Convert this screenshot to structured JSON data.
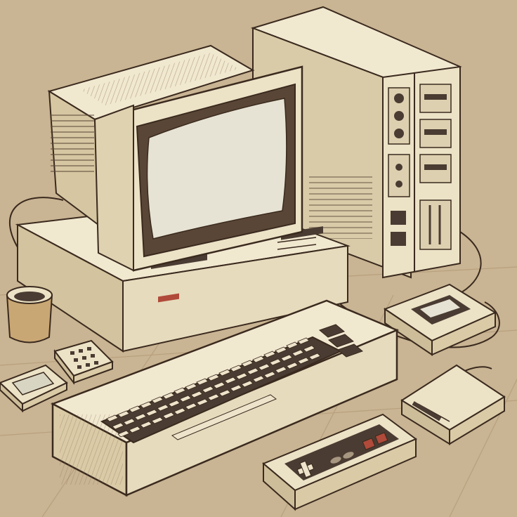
{
  "scene": {
    "subject": "retro-home-computer-setup",
    "palette": {
      "background": "#c9b493",
      "floor_line": "#b39c78",
      "cream": "#ece2c6",
      "cream_light": "#f4ecd6",
      "cream_shadow": "#d8c9a6",
      "side_shadow": "#c7b48d",
      "outline": "#3a2a1e",
      "screen": "#e6e3d4",
      "screen_bezel": "#5a4636",
      "key_dark": "#4a3c32",
      "key_light": "#eee4cb",
      "accent_red": "#b04a3a",
      "accent_amber": "#d08a3a"
    },
    "objects": [
      "crt-monitor",
      "computer-base-unit",
      "tower-pc",
      "keyboard",
      "game-controller",
      "floppy-drive",
      "cassette-drive",
      "small-handheld",
      "small-keypad-device",
      "pencil-cup",
      "cables"
    ]
  }
}
